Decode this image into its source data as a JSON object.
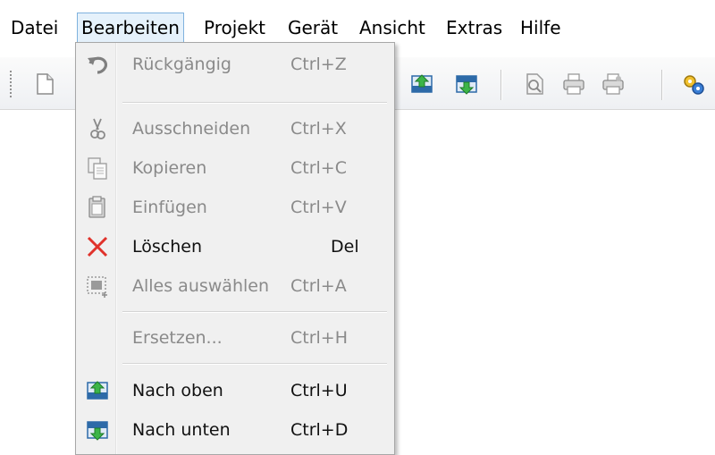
{
  "menubar": {
    "items": [
      {
        "label": "Datei"
      },
      {
        "label": "Bearbeiten"
      },
      {
        "label": "Projekt"
      },
      {
        "label": "Gerät"
      },
      {
        "label": "Ansicht"
      },
      {
        "label": "Extras"
      },
      {
        "label": "Hilfe"
      }
    ],
    "active_index": 1
  },
  "toolbar": {
    "icons": [
      "new-file-icon",
      "move-up-icon",
      "move-down-icon",
      "print-preview-icon",
      "print-icon",
      "print-setup-icon",
      "settings-gears-icon"
    ]
  },
  "dropdown": {
    "items": [
      {
        "label": "Rückgängig",
        "shortcut": "Ctrl+Z",
        "enabled": false,
        "icon": "undo-icon"
      },
      {
        "label": "Ausschneiden",
        "shortcut": "Ctrl+X",
        "enabled": false,
        "icon": "scissors-icon"
      },
      {
        "label": "Kopieren",
        "shortcut": "Ctrl+C",
        "enabled": false,
        "icon": "copy-icon"
      },
      {
        "label": "Einfügen",
        "shortcut": "Ctrl+V",
        "enabled": false,
        "icon": "paste-icon"
      },
      {
        "label": "Löschen",
        "shortcut": "Del",
        "enabled": true,
        "icon": "delete-x-icon"
      },
      {
        "label": "Alles auswählen",
        "shortcut": "Ctrl+A",
        "enabled": false,
        "icon": "select-all-icon"
      },
      {
        "label": "Ersetzen...",
        "shortcut": "Ctrl+H",
        "enabled": false,
        "icon": ""
      },
      {
        "label": "Nach oben",
        "shortcut": "Ctrl+U",
        "enabled": true,
        "icon": "move-up-icon"
      },
      {
        "label": "Nach unten",
        "shortcut": "Ctrl+D",
        "enabled": true,
        "icon": "move-down-icon"
      }
    ]
  },
  "colors": {
    "active_menu_bg": "#e5f1fb",
    "active_menu_border": "#7fb2de",
    "disabled_text": "#8a8a8a",
    "delete_red": "#e0322b"
  }
}
